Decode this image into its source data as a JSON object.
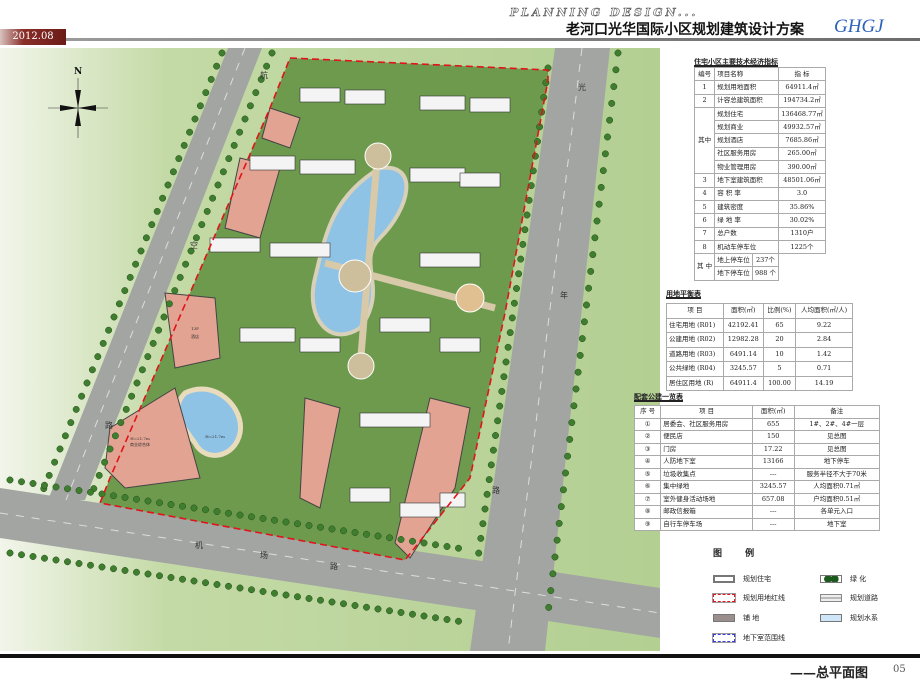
{
  "header": {
    "date": "2012.08",
    "en_title": "PLANNING DESIGN...",
    "cn_title": "老河口光华国际小区规划建筑设计方案",
    "brand": "GHGJ"
  },
  "map": {
    "north_label": "N",
    "roads": {
      "left": [
        "航",
        "空",
        "路"
      ],
      "right": [
        "光",
        "年",
        "路"
      ],
      "bottom": [
        "机",
        "场",
        "路"
      ]
    },
    "labels": {
      "commercial": "H=21.7m",
      "commercial_sub": "商业综合体",
      "hotel": "13F",
      "hotel_sub": "酒店",
      "pond": "H=21.7m"
    },
    "colors": {
      "ground": "#b9d39a",
      "road": "#a3a5a3",
      "building": "#f4f4f4",
      "commercial": "#e2a392",
      "water": "#8fc3e6",
      "green": "#5f9c45",
      "boundary": "#e0141a"
    }
  },
  "indicators": {
    "title": "住宅小区主要技术经济指标",
    "headers": [
      "编号",
      "项目名称",
      "指 标"
    ],
    "rows": [
      {
        "no": "1",
        "name": "规划用地面积",
        "value": "64911.4㎡"
      },
      {
        "no": "2",
        "name": "计容总建筑面积",
        "value": "194734.2㎡"
      },
      {
        "no": "其中",
        "name": "规划住宅",
        "value": "136468.77㎡"
      },
      {
        "name": "规划商业",
        "value": "49932.57㎡"
      },
      {
        "name": "规划酒店",
        "value": "7685.86㎡"
      },
      {
        "name": "社区服务用房",
        "value": "265.00㎡"
      },
      {
        "name": "物业管理用房",
        "value": "390.00㎡"
      },
      {
        "no": "3",
        "name": "地下室建筑面积",
        "value": "48501.06㎡"
      },
      {
        "no": "4",
        "name": "容 积 率",
        "value": "3.0"
      },
      {
        "no": "5",
        "name": "建筑密度",
        "value": "35.86%"
      },
      {
        "no": "6",
        "name": "绿 地 率",
        "value": "30.02%"
      },
      {
        "no": "7",
        "name": "总户数",
        "value": "1310户"
      },
      {
        "no": "8",
        "name": "机动车停车位",
        "value": "1225个"
      },
      {
        "no": "其 中",
        "name": "地上停车位",
        "value": "237个"
      },
      {
        "name": "地下停车位",
        "value": "988 个"
      }
    ]
  },
  "land_balance": {
    "title": "用地平衡表",
    "headers": [
      "项 目",
      "面积(㎡)",
      "比例(%)",
      "人均面积(㎡/人)"
    ],
    "rows": [
      [
        "住宅用地 (R01)",
        "42192.41",
        "65",
        "9.22"
      ],
      [
        "公建用地 (R02)",
        "12982.28",
        "20",
        "2.84"
      ],
      [
        "道路用地 (R03)",
        "6491.14",
        "10",
        "1.42"
      ],
      [
        "公共绿地 (R04)",
        "3245.57",
        "5",
        "0.71"
      ],
      [
        "居住区用地 (R)",
        "64911.4",
        "100.00",
        "14.19"
      ]
    ]
  },
  "facilities": {
    "title": "配套公建一览表",
    "headers": [
      "序 号",
      "项 目",
      "面积(㎡)",
      "备注"
    ],
    "rows": [
      [
        "①",
        "居委会、社区服务用房",
        "655",
        "1#、2#、4#一层"
      ],
      [
        "②",
        "便民店",
        "150",
        "见总图"
      ],
      [
        "③",
        "门房",
        "17.22",
        "见总图"
      ],
      [
        "④",
        "人防地下室",
        "13166",
        "地下停车"
      ],
      [
        "⑤",
        "垃圾收集点",
        "---",
        "服务半径不大于70米"
      ],
      [
        "⑥",
        "集中绿地",
        "3245.57",
        "人均面积0.71㎡"
      ],
      [
        "⑦",
        "室外健身活动场地",
        "657.08",
        "户均面积0.51㎡"
      ],
      [
        "⑧",
        "邮政信报箱",
        "---",
        "各单元入口"
      ],
      [
        "⑨",
        "自行车停车场",
        "---",
        "地下室"
      ]
    ]
  },
  "legend": {
    "title": "图 例",
    "items": [
      {
        "label": "规划住宅",
        "icon": "residential-swatch"
      },
      {
        "label": "绿  化",
        "icon": "greenery-swatch"
      },
      {
        "label": "规划用地红线",
        "icon": "red-line-swatch"
      },
      {
        "label": "规划道路",
        "icon": "road-swatch"
      },
      {
        "label": "铺  地",
        "icon": "paving-swatch"
      },
      {
        "label": "规划水系",
        "icon": "water-swatch"
      },
      {
        "label": "地下室范围线",
        "icon": "basement-line-swatch"
      }
    ]
  },
  "footer": {
    "title": "——总平面图",
    "page": "05"
  }
}
